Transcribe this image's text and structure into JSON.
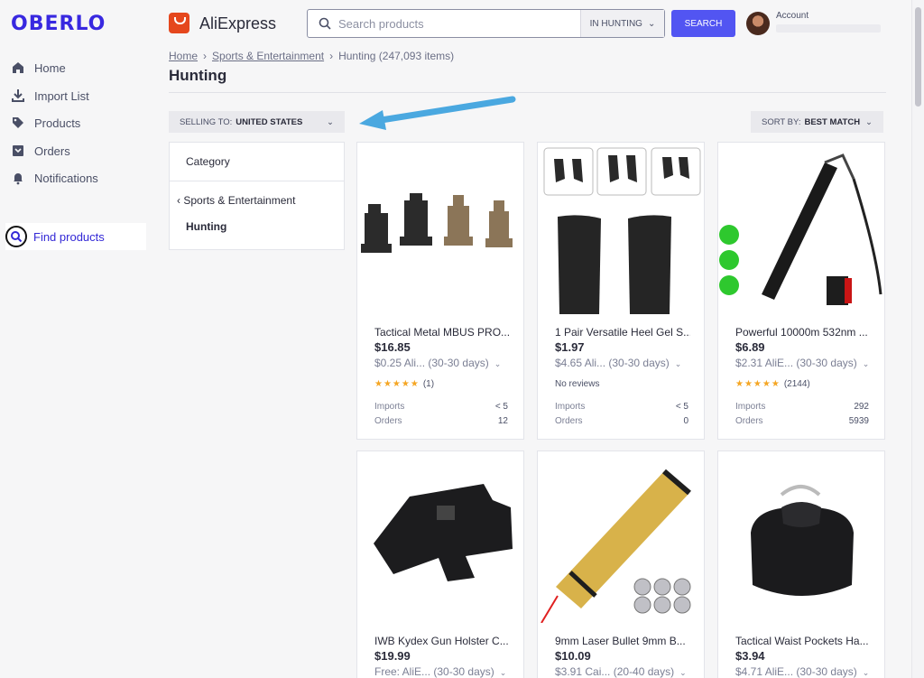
{
  "sidebar": {
    "logo": "OBERLO",
    "items": [
      {
        "label": "Home"
      },
      {
        "label": "Import List"
      },
      {
        "label": "Products"
      },
      {
        "label": "Orders"
      },
      {
        "label": "Notifications"
      }
    ],
    "find_products": "Find products"
  },
  "header": {
    "brand": "AliExpress",
    "search_placeholder": "Search products",
    "search_scope": "IN HUNTING",
    "search_button": "SEARCH",
    "account_label": "Account"
  },
  "breadcrumb": {
    "home": "Home",
    "category": "Sports & Entertainment",
    "current": "Hunting (247,093 items)"
  },
  "page_title": "Hunting",
  "filters": {
    "selling_label": "SELLING TO:",
    "selling_value": "UNITED STATES",
    "sort_label": "SORT BY:",
    "sort_value": "BEST MATCH"
  },
  "category_panel": {
    "heading": "Category",
    "parent": "Sports & Entertainment",
    "current": "Hunting"
  },
  "products": [
    {
      "title": "Tactical Metal MBUS PRO...",
      "price": "$16.85",
      "shipping": "$0.25 Ali...",
      "days": "(30-30 days)",
      "stars": "★★★★★",
      "reviews": "(1)",
      "imports_label": "Imports",
      "imports": "< 5",
      "orders_label": "Orders",
      "orders": "12"
    },
    {
      "title": "1 Pair Versatile Heel Gel S...",
      "price": "$1.97",
      "shipping": "$4.65 Ali...",
      "days": "(30-30 days)",
      "no_reviews": "No reviews",
      "imports_label": "Imports",
      "imports": "< 5",
      "orders_label": "Orders",
      "orders": "0"
    },
    {
      "title": "Powerful 10000m 532nm ...",
      "price": "$6.89",
      "shipping": "$2.31 AliE...",
      "days": "(30-30 days)",
      "stars": "★★★★★",
      "reviews": "(2144)",
      "imports_label": "Imports",
      "imports": "292",
      "orders_label": "Orders",
      "orders": "5939"
    },
    {
      "title": "IWB Kydex Gun Holster C...",
      "price": "$19.99",
      "shipping": "Free: AliE...",
      "days": "(30-30 days)"
    },
    {
      "title": "9mm Laser Bullet 9mm B...",
      "price": "$10.09",
      "shipping": "$3.91 Cai...",
      "days": "(20-40 days)"
    },
    {
      "title": "Tactical Waist Pockets Ha...",
      "price": "$3.94",
      "shipping": "$4.71 AliE...",
      "days": "(30-30 days)"
    }
  ],
  "colors": {
    "accent": "#5255f2",
    "brand": "#3828e0",
    "arrow": "#4aa8e0",
    "star": "#f5a623"
  }
}
